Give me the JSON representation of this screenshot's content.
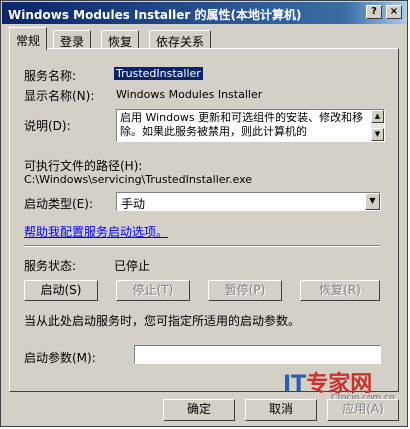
{
  "window": {
    "title": "Windows Modules Installer 的属性(本地计算机)"
  },
  "titlebar": {
    "help_glyph": "?",
    "close_glyph": "×"
  },
  "tabs": [
    {
      "label": "常规",
      "active": true
    },
    {
      "label": "登录",
      "active": false
    },
    {
      "label": "恢复",
      "active": false
    },
    {
      "label": "依存关系",
      "active": false
    }
  ],
  "general": {
    "service_name_label": "服务名称:",
    "service_name_value": "TrustedInstaller",
    "display_name_label": "显示名称(N):",
    "display_name_value": "Windows Modules Installer",
    "description_label": "说明(D):",
    "description_value": "启用 Windows 更新和可选组件的安装、修改和移除。如果此服务被禁用，则此计算机的",
    "exe_path_label": "可执行文件的路径(H):",
    "exe_path_value": "C:\\Windows\\servicing\\TrustedInstaller.exe",
    "startup_type_label": "启动类型(E):",
    "startup_type_value": "手动",
    "help_link": "帮助我配置服务启动选项。",
    "status_label": "服务状态:",
    "status_value": "已停止",
    "start_button": "启动(S)",
    "stop_button": "停止(T)",
    "pause_button": "暂停(P)",
    "resume_button": "恢复(R)",
    "hint_text": "当从此处启动服务时，您可指定所适用的启动参数。",
    "params_label": "启动参数(M):",
    "params_value": ""
  },
  "footer": {
    "ok_button": "确定",
    "cancel_button": "取消",
    "apply_button": "应用(A)"
  },
  "watermark": {
    "logo_it": "IT",
    "logo_rest": "专家网",
    "site": "Ctocio.com.cn"
  }
}
